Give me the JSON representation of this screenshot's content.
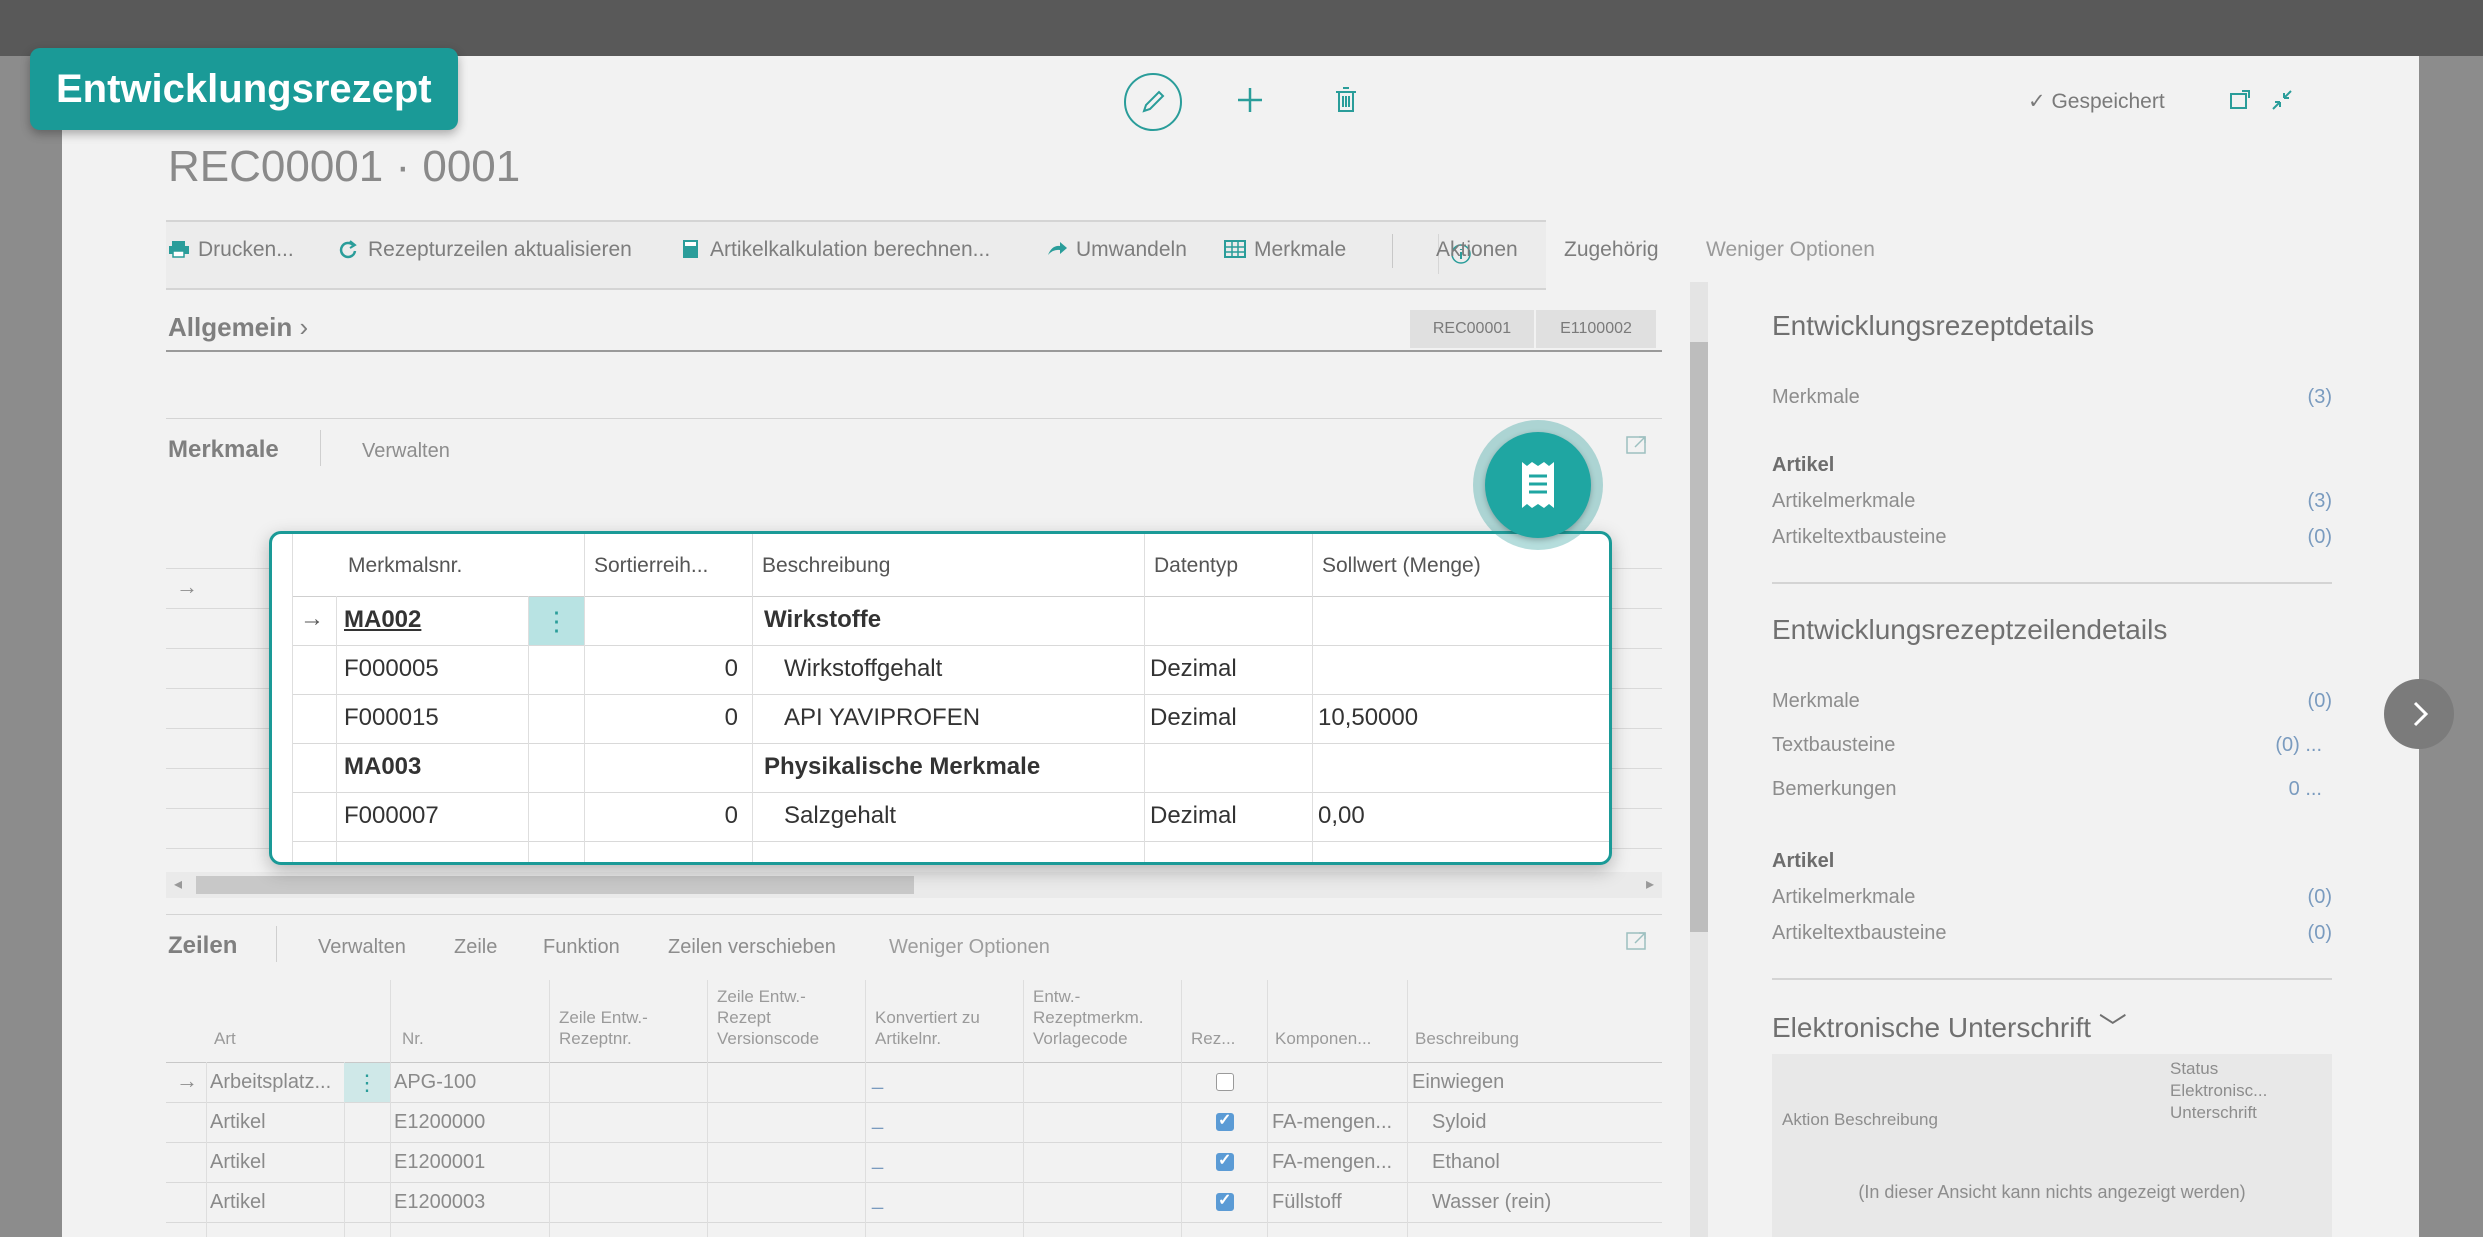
{
  "tag": "Entwicklungsrezept",
  "header": {
    "record_title": "REC00001 · 0001",
    "saved_status": "Gespeichert"
  },
  "toolbar": {
    "items": [
      "Drucken...",
      "Rezepturzeilen aktualisieren",
      "Artikelkalkulation berechnen...",
      "Umwandeln",
      "Merkmale",
      "Aktionen",
      "Zugehörig",
      "Weniger Optionen"
    ]
  },
  "general": {
    "title": "Allgemein",
    "badge1": "REC00001",
    "badge2": "E1100002"
  },
  "merkmale_part": {
    "title": "Merkmale",
    "manage": "Verwalten"
  },
  "popup": {
    "headers": [
      "Merkmalsnr.",
      "Sortierreih...",
      "Beschreibung",
      "Datentyp",
      "Sollwert (Menge)"
    ],
    "rows": [
      {
        "nr": "MA002",
        "sort": "",
        "desc": "Wirkstoffe",
        "type": "",
        "value": ""
      },
      {
        "nr": "F000005",
        "sort": "0",
        "desc": "Wirkstoffgehalt",
        "type": "Dezimal",
        "value": ""
      },
      {
        "nr": "F000015",
        "sort": "0",
        "desc": "API YAVIPROFEN",
        "type": "Dezimal",
        "value": "10,50000"
      },
      {
        "nr": "MA003",
        "sort": "",
        "desc": "Physikalische Merkmale",
        "type": "",
        "value": ""
      },
      {
        "nr": "F000007",
        "sort": "0",
        "desc": "Salzgehalt",
        "type": "Dezimal",
        "value": "0,00"
      }
    ]
  },
  "zeilen": {
    "title": "Zeilen",
    "actions": [
      "Verwalten",
      "Zeile",
      "Funktion",
      "Zeilen verschieben",
      "Weniger Optionen"
    ],
    "headers": {
      "art": "Art",
      "nr": "Nr.",
      "zeile_nr": "Zeile Entw.-\nRezeptnr.",
      "zeile_vc": "Zeile Entw.-\nRezept\nVersionscode",
      "konv": "Konvertiert zu\nArtikelnr.",
      "vorlage": "Entw.-\nRezeptmerkm.\nVorlagecode",
      "rez": "Rez...",
      "komp": "Komponen...",
      "besch": "Beschreibung"
    },
    "rows": [
      {
        "art": "Arbeitsplatz...",
        "nr": "APG-100",
        "konv": "_",
        "checked": false,
        "komp": "",
        "besch": "Einwiegen"
      },
      {
        "art": "Artikel",
        "nr": "E1200000",
        "konv": "_",
        "checked": true,
        "komp": "FA-mengen...",
        "besch": "Syloid"
      },
      {
        "art": "Artikel",
        "nr": "E1200001",
        "konv": "_",
        "checked": true,
        "komp": "FA-mengen...",
        "besch": "Ethanol"
      },
      {
        "art": "Artikel",
        "nr": "E1200003",
        "konv": "_",
        "checked": true,
        "komp": "Füllstoff",
        "besch": "Wasser (rein)"
      }
    ]
  },
  "factbox": {
    "details_title": "Entwicklungsrezeptdetails",
    "merkmale_label": "Merkmale",
    "merkmale_val": "(3)",
    "artikel_title": "Artikel",
    "artikelmerkmale_label": "Artikelmerkmale",
    "artikelmerkmale_val": "(3)",
    "artikeltext_label": "Artikeltextbausteine",
    "artikeltext_val": "(0)",
    "lines_title": "Entwicklungsrezeptzeilendetails",
    "l_merkmale_label": "Merkmale",
    "l_merkmale_val": "(0)",
    "l_text_label": "Textbausteine",
    "l_text_val": "(0) ...",
    "l_bem_label": "Bemerkungen",
    "l_bem_val": "0 ...",
    "l_artikel_title": "Artikel",
    "l_artikelmerkmale_label": "Artikelmerkmale",
    "l_artikelmerkmale_val": "(0)",
    "l_artikeltext_label": "Artikeltextbausteine",
    "l_artikeltext_val": "(0)",
    "sig_title": "Elektronische Unterschrift",
    "sig_col1": "Aktion Beschreibung",
    "sig_col2": "Status\nElektronisc...\nUnterschrift",
    "sig_empty": "(In dieser Ansicht kann nichts angezeigt werden)"
  }
}
